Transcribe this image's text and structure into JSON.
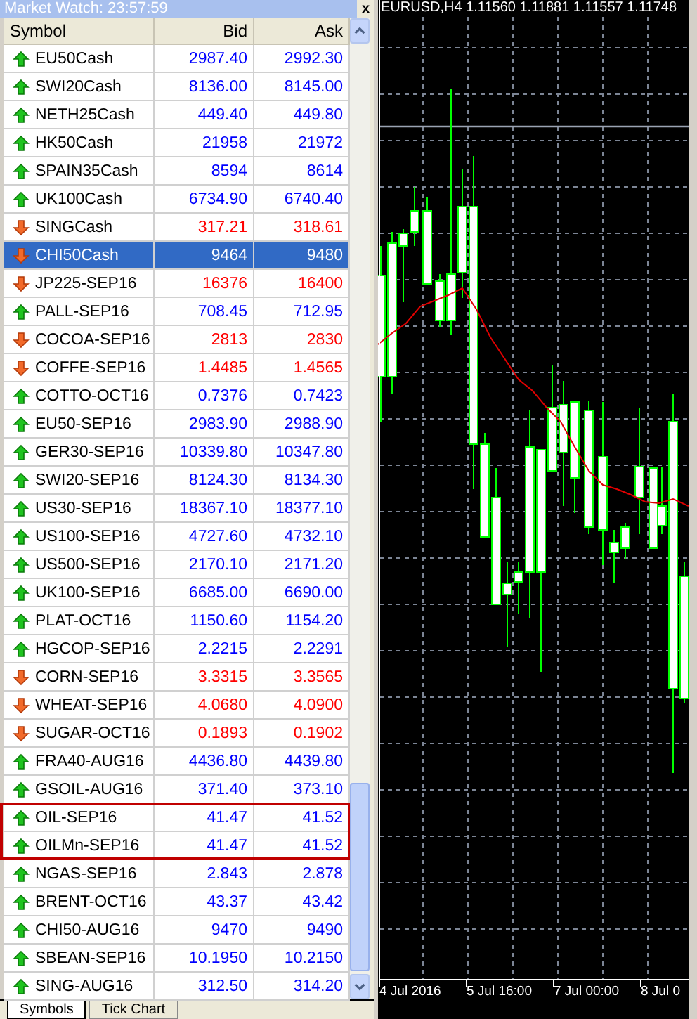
{
  "market_watch": {
    "title": "Market Watch: 23:57:59",
    "close": "x",
    "columns": [
      "Symbol",
      "Bid",
      "Ask"
    ],
    "rows": [
      {
        "symbol": "EU50Cash",
        "bid": "2987.40",
        "ask": "2992.30",
        "kind": "up",
        "selected": false,
        "boxed": false
      },
      {
        "symbol": "SWI20Cash",
        "bid": "8136.00",
        "ask": "8145.00",
        "kind": "up",
        "selected": false,
        "boxed": false
      },
      {
        "symbol": "NETH25Cash",
        "bid": "449.40",
        "ask": "449.80",
        "kind": "up",
        "selected": false,
        "boxed": false
      },
      {
        "symbol": "HK50Cash",
        "bid": "21958",
        "ask": "21972",
        "kind": "up",
        "selected": false,
        "boxed": false
      },
      {
        "symbol": "SPAIN35Cash",
        "bid": "8594",
        "ask": "8614",
        "kind": "up",
        "selected": false,
        "boxed": false
      },
      {
        "symbol": "UK100Cash",
        "bid": "6734.90",
        "ask": "6740.40",
        "kind": "up",
        "selected": false,
        "boxed": false
      },
      {
        "symbol": "SINGCash",
        "bid": "317.21",
        "ask": "318.61",
        "kind": "down",
        "selected": false,
        "boxed": false
      },
      {
        "symbol": "CHI50Cash",
        "bid": "9464",
        "ask": "9480",
        "kind": "down",
        "selected": true,
        "boxed": false
      },
      {
        "symbol": "JP225-SEP16",
        "bid": "16376",
        "ask": "16400",
        "kind": "down",
        "selected": false,
        "boxed": false
      },
      {
        "symbol": "PALL-SEP16",
        "bid": "708.45",
        "ask": "712.95",
        "kind": "up",
        "selected": false,
        "boxed": false
      },
      {
        "symbol": "COCOA-SEP16",
        "bid": "2813",
        "ask": "2830",
        "kind": "down",
        "selected": false,
        "boxed": false
      },
      {
        "symbol": "COFFE-SEP16",
        "bid": "1.4485",
        "ask": "1.4565",
        "kind": "down",
        "selected": false,
        "boxed": false
      },
      {
        "symbol": "COTTO-OCT16",
        "bid": "0.7376",
        "ask": "0.7423",
        "kind": "up",
        "selected": false,
        "boxed": false
      },
      {
        "symbol": "EU50-SEP16",
        "bid": "2983.90",
        "ask": "2988.90",
        "kind": "up",
        "selected": false,
        "boxed": false
      },
      {
        "symbol": "GER30-SEP16",
        "bid": "10339.80",
        "ask": "10347.80",
        "kind": "up",
        "selected": false,
        "boxed": false
      },
      {
        "symbol": "SWI20-SEP16",
        "bid": "8124.30",
        "ask": "8134.30",
        "kind": "up",
        "selected": false,
        "boxed": false
      },
      {
        "symbol": "US30-SEP16",
        "bid": "18367.10",
        "ask": "18377.10",
        "kind": "up",
        "selected": false,
        "boxed": false
      },
      {
        "symbol": "US100-SEP16",
        "bid": "4727.60",
        "ask": "4732.10",
        "kind": "up",
        "selected": false,
        "boxed": false
      },
      {
        "symbol": "US500-SEP16",
        "bid": "2170.10",
        "ask": "2171.20",
        "kind": "up",
        "selected": false,
        "boxed": false
      },
      {
        "symbol": "UK100-SEP16",
        "bid": "6685.00",
        "ask": "6690.00",
        "kind": "up",
        "selected": false,
        "boxed": false
      },
      {
        "symbol": "PLAT-OCT16",
        "bid": "1150.60",
        "ask": "1154.20",
        "kind": "up",
        "selected": false,
        "boxed": false
      },
      {
        "symbol": "HGCOP-SEP16",
        "bid": "2.2215",
        "ask": "2.2291",
        "kind": "up",
        "selected": false,
        "boxed": false
      },
      {
        "symbol": "CORN-SEP16",
        "bid": "3.3315",
        "ask": "3.3565",
        "kind": "down",
        "selected": false,
        "boxed": false
      },
      {
        "symbol": "WHEAT-SEP16",
        "bid": "4.0680",
        "ask": "4.0900",
        "kind": "down",
        "selected": false,
        "boxed": false
      },
      {
        "symbol": "SUGAR-OCT16",
        "bid": "0.1893",
        "ask": "0.1902",
        "kind": "down",
        "selected": false,
        "boxed": false
      },
      {
        "symbol": "FRA40-AUG16",
        "bid": "4436.80",
        "ask": "4439.80",
        "kind": "up",
        "selected": false,
        "boxed": false
      },
      {
        "symbol": "GSOIL-AUG16",
        "bid": "371.40",
        "ask": "373.10",
        "kind": "up",
        "selected": false,
        "boxed": false
      },
      {
        "symbol": "OIL-SEP16",
        "bid": "41.47",
        "ask": "41.52",
        "kind": "up",
        "selected": false,
        "boxed": true
      },
      {
        "symbol": "OILMn-SEP16",
        "bid": "41.47",
        "ask": "41.52",
        "kind": "up",
        "selected": false,
        "boxed": true
      },
      {
        "symbol": "NGAS-SEP16",
        "bid": "2.843",
        "ask": "2.878",
        "kind": "up",
        "selected": false,
        "boxed": false
      },
      {
        "symbol": "BRENT-OCT16",
        "bid": "43.37",
        "ask": "43.42",
        "kind": "up",
        "selected": false,
        "boxed": false
      },
      {
        "symbol": "CHI50-AUG16",
        "bid": "9470",
        "ask": "9490",
        "kind": "up",
        "selected": false,
        "boxed": false
      },
      {
        "symbol": "SBEAN-SEP16",
        "bid": "10.1950",
        "ask": "10.2150",
        "kind": "up",
        "selected": false,
        "boxed": false
      },
      {
        "symbol": "SING-AUG16",
        "bid": "312.50",
        "ask": "314.20",
        "kind": "up",
        "selected": false,
        "boxed": false
      }
    ],
    "tabs": [
      {
        "label": "Symbols",
        "selected": true
      },
      {
        "label": "Tick Chart",
        "selected": false
      }
    ]
  },
  "chart": {
    "header": "EURUSD,H4  1.11560 1.11881 1.11557 1.11748",
    "time_labels": [
      "4 Jul 2016",
      "5 Jul 16:00",
      "7 Jul 00:00",
      "8 Jul 0"
    ]
  }
}
